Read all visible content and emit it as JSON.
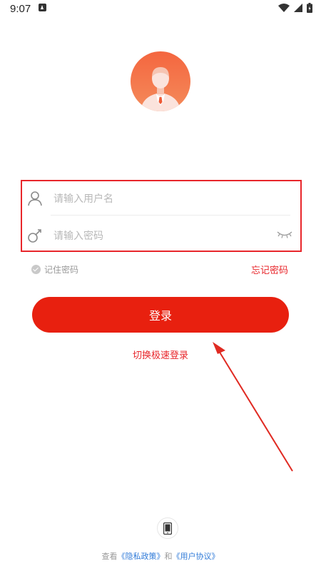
{
  "status": {
    "time": "9:07"
  },
  "login": {
    "username_placeholder": "请输入用户名",
    "password_placeholder": "请输入密码",
    "remember_label": "记住密码",
    "forgot_label": "忘记密码",
    "login_label": "登录",
    "switch_label": "切换极速登录"
  },
  "footer": {
    "prefix": "查看",
    "privacy_link": "《隐私政策》",
    "conj": "和",
    "agreement_link": "《用户协议》"
  },
  "colors": {
    "accent": "#e8200f",
    "link_blue": "#2f7ad8"
  },
  "icons": [
    "avatar-icon",
    "user-icon",
    "key-icon",
    "eye-closed-icon",
    "check-icon",
    "phone-icon"
  ]
}
